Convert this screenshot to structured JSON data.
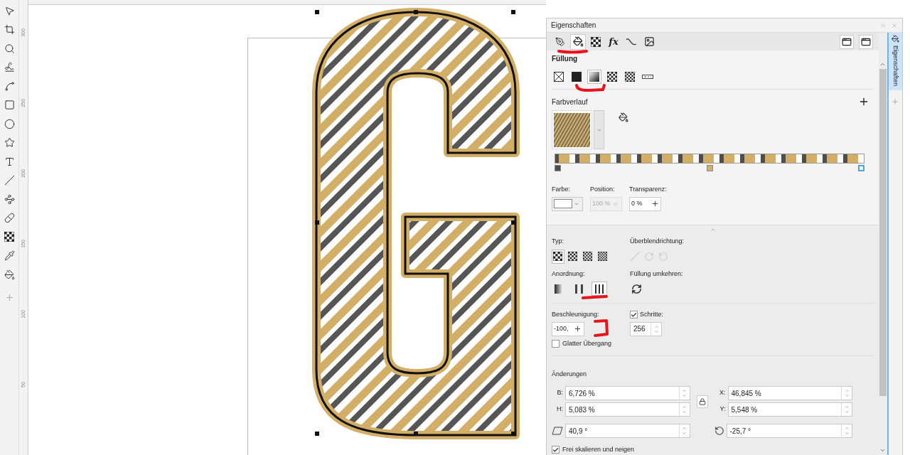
{
  "rulers": {
    "vertical_labels": [
      "300",
      "250",
      "200",
      "150",
      "100",
      "50"
    ]
  },
  "panel": {
    "title": "Eigenschaften",
    "tabs": [
      {
        "kind": "outline",
        "selected": false
      },
      {
        "kind": "fill",
        "selected": true
      },
      {
        "kind": "transparency",
        "selected": false
      },
      {
        "kind": "effects",
        "label": "fx",
        "selected": false
      },
      {
        "kind": "curve",
        "selected": false
      },
      {
        "kind": "bitmap",
        "selected": false
      }
    ],
    "fill": {
      "heading": "Füllung",
      "types": [
        {
          "kind": "none",
          "selected": false
        },
        {
          "kind": "uniform",
          "selected": false
        },
        {
          "kind": "fountain",
          "selected": true
        },
        {
          "kind": "vector",
          "selected": false
        },
        {
          "kind": "bitmap",
          "selected": false
        },
        {
          "kind": "postscript",
          "selected": false
        }
      ]
    },
    "gradient": {
      "heading": "Farbverlauf",
      "stops": [
        {
          "color": "#4d4d4d",
          "selected": false
        },
        {
          "color": "#d3ae66",
          "selected": false
        },
        {
          "color": "#ffffff",
          "selected": true
        }
      ],
      "color_label": "Farbe:",
      "position_label": "Position:",
      "position_value": "100 %",
      "transparency_label": "Transparenz:",
      "transparency_value": "0 %"
    },
    "type": {
      "label": "Typ:",
      "options": [
        {
          "selected": true
        },
        {
          "selected": false
        },
        {
          "selected": false
        },
        {
          "selected": false
        }
      ]
    },
    "direction_label": "Überblendrichtung:",
    "arrangement": {
      "label": "Anordnung:",
      "options": [
        {
          "kind": "default",
          "selected": false
        },
        {
          "kind": "mirror",
          "selected": false
        },
        {
          "kind": "repeat",
          "selected": true
        }
      ]
    },
    "reverse_label": "Füllung umkehren:",
    "acceleration": {
      "label": "Beschleunigung:",
      "value": "-100,"
    },
    "steps": {
      "label": "Schritte:",
      "checked": true,
      "value": "256"
    },
    "smooth": {
      "label": "Glatter Übergang",
      "checked": false
    },
    "changes": {
      "heading": "Änderungen",
      "fields": [
        {
          "label": "B:",
          "value": "6,726 %"
        },
        {
          "label": "X:",
          "value": "46,845 %"
        },
        {
          "label": "H:",
          "value": "5,083 %"
        },
        {
          "label": "Y:",
          "value": "5,548 %"
        }
      ],
      "skew": "40,9 °",
      "rotation": "-25,7 °"
    },
    "free_scale": {
      "label": "Frei skalieren und neigen",
      "checked": true
    },
    "side_tab": "Eigenschaften"
  }
}
